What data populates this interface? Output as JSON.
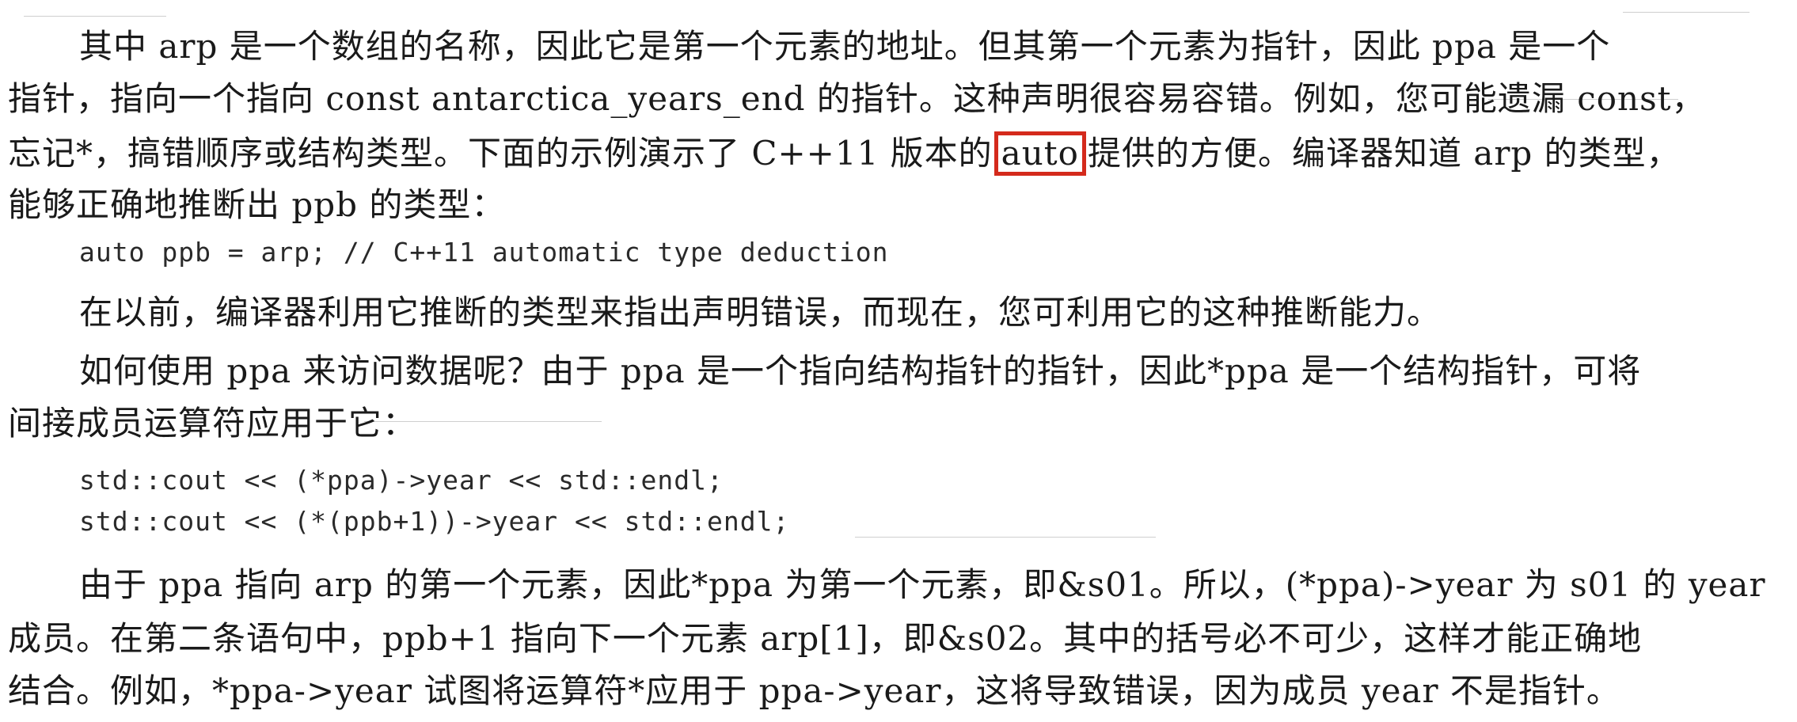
{
  "document": {
    "lines": [
      "其中 arp 是一个数组的名称，因此它是第一个元素的地址。但其第一个元素为指针，因此 ppa 是一个",
      "指针，指向一个指向 const antarctica_years_end 的指针。这种声明很容易容错。例如，您可能遗漏 const，",
      "能够正确地推断出 ppb 的类型：",
      "在以前，编译器利用它推断的类型来指出声明错误，而现在，您可利用它的这种推断能力。",
      "如何使用 ppa 来访问数据呢？由于 ppa 是一个指向结构指针的指针，因此*ppa 是一个结构指针，可将",
      "间接成员运算符应用于它：",
      "由于 ppa 指向 arp 的第一个元素，因此*ppa 为第一个元素，即&s01。所以，(*ppa)->year 为 s01 的 year",
      "成员。在第二条语句中，ppb+1 指向下一个元素 arp[1]，即&s02。其中的括号必不可少，这样才能正确地",
      "结合。例如，*ppa->year 试图将运算符*应用于 ppa->year，这将导致错误，因为成员 year 不是指针。"
    ],
    "line3": {
      "before": "忘记*，搞错顺序或结构类型。下面的示例演示了 C++11 版本的",
      "highlight": "auto",
      "after": "提供的方便。编译器知道 arp 的类型，"
    },
    "code_blocks": [
      [
        "auto ppb = arp; // C++11 automatic type deduction"
      ],
      [
        "std::cout << (*ppa)->year << std::endl;",
        "std::cout << (*(ppb+1))->year << std::endl;"
      ]
    ]
  },
  "colors": {
    "highlight_border": "#d42a1c",
    "text": "#1a1a1a",
    "code_text": "#2a2a2a"
  }
}
